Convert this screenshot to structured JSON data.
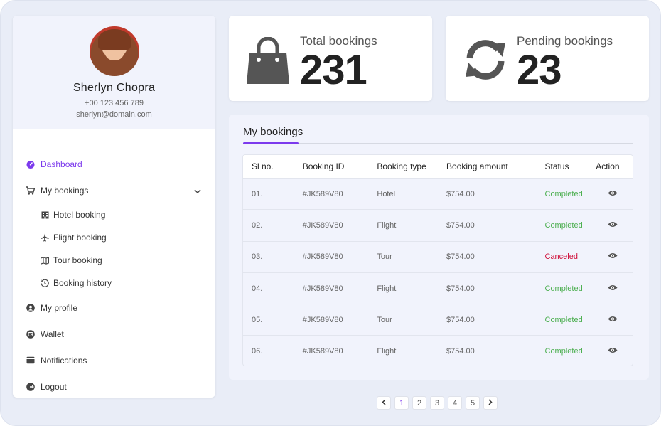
{
  "profile": {
    "name": "Sherlyn Chopra",
    "phone": "+00 123 456 789",
    "email": "sherlyn@domain.com"
  },
  "menu": {
    "dashboard": "Dashboard",
    "my_bookings": "My bookings",
    "hotel_booking": "Hotel booking",
    "flight_booking": "Flight booking",
    "tour_booking": "Tour booking",
    "booking_history": "Booking history",
    "my_profile": "My profile",
    "wallet": "Wallet",
    "notifications": "Notifications",
    "logout": "Logout"
  },
  "stats": {
    "total_label": "Total bookings",
    "total_value": "231",
    "pending_label": "Pending bookings",
    "pending_value": "23"
  },
  "bookings": {
    "title": "My bookings",
    "headers": [
      "Sl no.",
      "Booking ID",
      "Booking type",
      "Booking amount",
      "Status",
      "Action"
    ],
    "rows": [
      {
        "sl": "01.",
        "id": "#JK589V80",
        "type": "Hotel",
        "amount": "$754.00",
        "status": "Completed"
      },
      {
        "sl": "02.",
        "id": "#JK589V80",
        "type": "Flight",
        "amount": "$754.00",
        "status": "Completed"
      },
      {
        "sl": "03.",
        "id": "#JK589V80",
        "type": "Tour",
        "amount": "$754.00",
        "status": "Canceled"
      },
      {
        "sl": "04.",
        "id": "#JK589V80",
        "type": "Flight",
        "amount": "$754.00",
        "status": "Completed"
      },
      {
        "sl": "05.",
        "id": "#JK589V80",
        "type": "Tour",
        "amount": "$754.00",
        "status": "Completed"
      },
      {
        "sl": "06.",
        "id": "#JK589V80",
        "type": "Flight",
        "amount": "$754.00",
        "status": "Completed"
      }
    ]
  },
  "pagination": {
    "prev": "‹",
    "pages": [
      "1",
      "2",
      "3",
      "4",
      "5"
    ],
    "next": "›"
  },
  "colors": {
    "accent": "#7c3aed",
    "completed": "#4caf50",
    "canceled": "#d0103a"
  },
  "icons": {
    "dashboard": "dashboard-icon",
    "cart": "cart-icon",
    "hotel": "building-icon",
    "flight": "plane-icon",
    "tour": "map-icon",
    "history": "history-icon",
    "profile": "user-icon",
    "wallet": "wallet-icon",
    "notifications": "notification-icon",
    "logout": "logout-icon",
    "total": "shopping-bag-icon",
    "pending": "refresh-icon",
    "view": "eye-icon"
  }
}
